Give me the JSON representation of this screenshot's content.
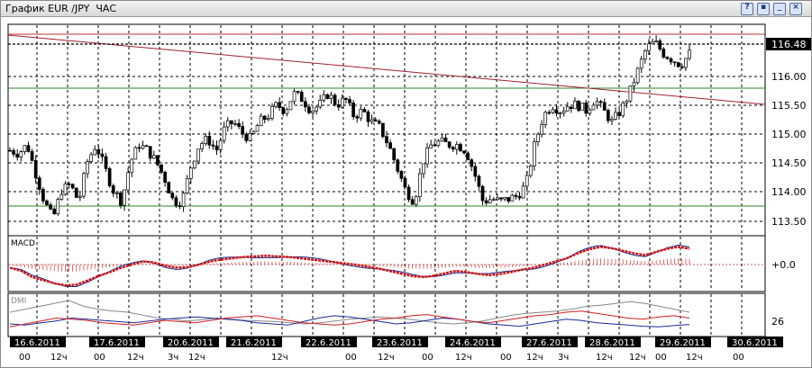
{
  "window": {
    "title": "График EUR /JPY  ЧАС",
    "buttons": [
      "help-icon",
      "save-icon",
      "minimize-icon",
      "close-icon"
    ]
  },
  "colors": {
    "candles": "#000000",
    "resistance_line": "#c03030",
    "trend_line": "#a02030",
    "support_lines": "#2a8a2a",
    "macd_line": "#1a2a8a",
    "macd_signal": "#d01010",
    "dmi_adx": "#888888",
    "dmi_plus": "#1a2a9a",
    "dmi_minus": "#d02020",
    "date_label_bg": "#000000",
    "date_label_text": "#ffffff"
  },
  "price_panel": {
    "current_price": "116.48",
    "price_ticks": [
      "116.00",
      "115.50",
      "115.00",
      "114.50",
      "114.00",
      "113.50"
    ]
  },
  "macd_panel": {
    "label": "MACD",
    "tick": "+0.0"
  },
  "dmi_panel": {
    "label": "DMI",
    "tick": "26"
  },
  "time_axis": {
    "dates": [
      "16.6.2011",
      "17.6.2011",
      "20.6.2011",
      "21.6.2011",
      "22.6.2011",
      "23.6.2011",
      "24.6.2011",
      "27.6.2011",
      "28.6.2011",
      "29.6.2011",
      "30.6.2011"
    ],
    "hours": [
      "00",
      "12ч",
      "00",
      "12ч",
      "3ч",
      "12ч",
      "12ч",
      "00",
      "12ч",
      "00",
      "12ч",
      "00",
      "12ч",
      "3ч",
      "12ч",
      "12ч",
      "00",
      "12ч",
      "00",
      "12ч",
      "00"
    ]
  },
  "chart_data": {
    "type": "candlestick",
    "instrument": "EUR /JPY",
    "timeframe": "ЧАС",
    "price_ylim": [
      113.3,
      117.0
    ],
    "horizontal_levels": [
      116.68,
      115.78,
      113.76
    ],
    "trend_line": {
      "start": 116.66,
      "end": 115.48
    },
    "price_path": [
      114.8,
      114.75,
      114.9,
      114.4,
      113.9,
      113.6,
      114.1,
      114.2,
      113.9,
      114.6,
      114.9,
      114.5,
      114.1,
      113.9,
      114.6,
      114.9,
      114.8,
      114.6,
      114.3,
      113.9,
      113.9,
      114.5,
      114.9,
      115.0,
      114.8,
      115.2,
      115.3,
      115.1,
      115.0,
      115.3,
      115.4,
      115.6,
      115.5,
      115.8,
      115.7,
      115.5,
      115.6,
      115.8,
      115.6,
      115.7,
      115.4,
      115.5,
      115.3,
      115.2,
      114.9,
      114.5,
      114.1,
      113.9,
      114.6,
      114.9,
      114.95,
      114.9,
      114.9,
      114.8,
      114.4,
      113.9,
      113.95,
      113.9,
      113.95,
      114.0,
      114.2,
      114.9,
      115.4,
      115.6,
      115.5,
      115.6,
      115.6,
      115.5,
      115.7,
      115.5,
      115.3,
      115.5,
      115.8,
      116.2,
      116.6,
      116.7,
      116.5,
      116.4,
      116.3,
      116.5
    ],
    "macd_path": [
      -0.05,
      -0.1,
      -0.2,
      -0.25,
      -0.3,
      -0.33,
      -0.32,
      -0.25,
      -0.18,
      -0.12,
      -0.05,
      0.0,
      0.05,
      0.03,
      -0.02,
      -0.05,
      -0.04,
      0.0,
      0.05,
      0.08,
      0.1,
      0.12,
      0.13,
      0.14,
      0.13,
      0.12,
      0.1,
      0.08,
      0.06,
      0.04,
      0.02,
      0.0,
      -0.03,
      -0.06,
      -0.1,
      -0.14,
      -0.18,
      -0.2,
      -0.18,
      -0.14,
      -0.1,
      -0.12,
      -0.15,
      -0.17,
      -0.15,
      -0.12,
      -0.08,
      -0.05,
      0.0,
      0.05,
      0.1,
      0.18,
      0.24,
      0.28,
      0.26,
      0.22,
      0.18,
      0.15,
      0.2,
      0.25,
      0.28,
      0.25
    ],
    "dmi_adx": [
      40,
      45,
      50,
      55,
      60,
      50,
      45,
      42,
      40,
      35,
      30,
      28,
      25,
      27,
      30,
      28,
      26,
      25,
      24,
      22,
      20,
      22,
      25,
      28,
      30,
      32,
      30,
      28,
      25,
      22,
      20,
      22,
      25,
      30,
      35,
      38,
      40,
      42,
      45,
      50,
      52,
      55,
      58,
      55,
      50,
      45,
      40
    ],
    "dmi_plus": [
      20,
      18,
      22,
      25,
      30,
      28,
      26,
      24,
      22,
      25,
      28,
      30,
      32,
      30,
      28,
      26,
      22,
      20,
      18,
      24,
      30,
      34,
      32,
      28,
      24,
      20,
      22,
      26,
      30,
      28,
      24,
      20,
      18,
      16,
      20,
      24,
      28,
      26,
      22,
      20,
      18,
      16,
      15,
      17,
      19
    ],
    "dmi_minus": [
      15,
      20,
      25,
      30,
      28,
      26,
      22,
      20,
      18,
      22,
      26,
      24,
      22,
      26,
      30,
      32,
      34,
      30,
      26,
      22,
      20,
      18,
      20,
      24,
      28,
      30,
      34,
      36,
      32,
      28,
      24,
      22,
      26,
      30,
      34,
      36,
      40,
      42,
      38,
      34,
      30,
      28,
      32,
      34,
      30
    ]
  }
}
